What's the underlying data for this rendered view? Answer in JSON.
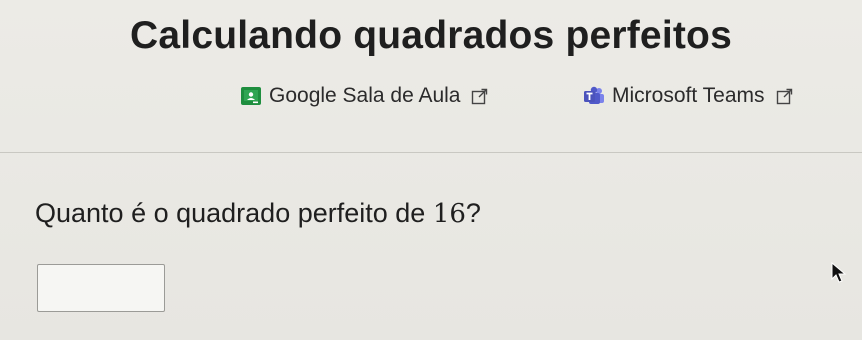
{
  "page": {
    "title": "Calculando quadrados perfeitos"
  },
  "share": {
    "google_label": "Google Sala de Aula",
    "teams_label": "Microsoft Teams"
  },
  "question": {
    "prefix": "Quanto é o quadrado perfeito de ",
    "number": "16",
    "suffix": "?"
  },
  "answer": {
    "value": "",
    "placeholder": ""
  },
  "colors": {
    "google_classroom_green": "#1e8e3e",
    "teams_purple": "#4b53bc",
    "text": "#1f1f1f"
  },
  "icons": {
    "google": "google-classroom-icon",
    "teams": "microsoft-teams-icon",
    "external": "external-link-icon",
    "pointer": "mouse-pointer-icon"
  }
}
